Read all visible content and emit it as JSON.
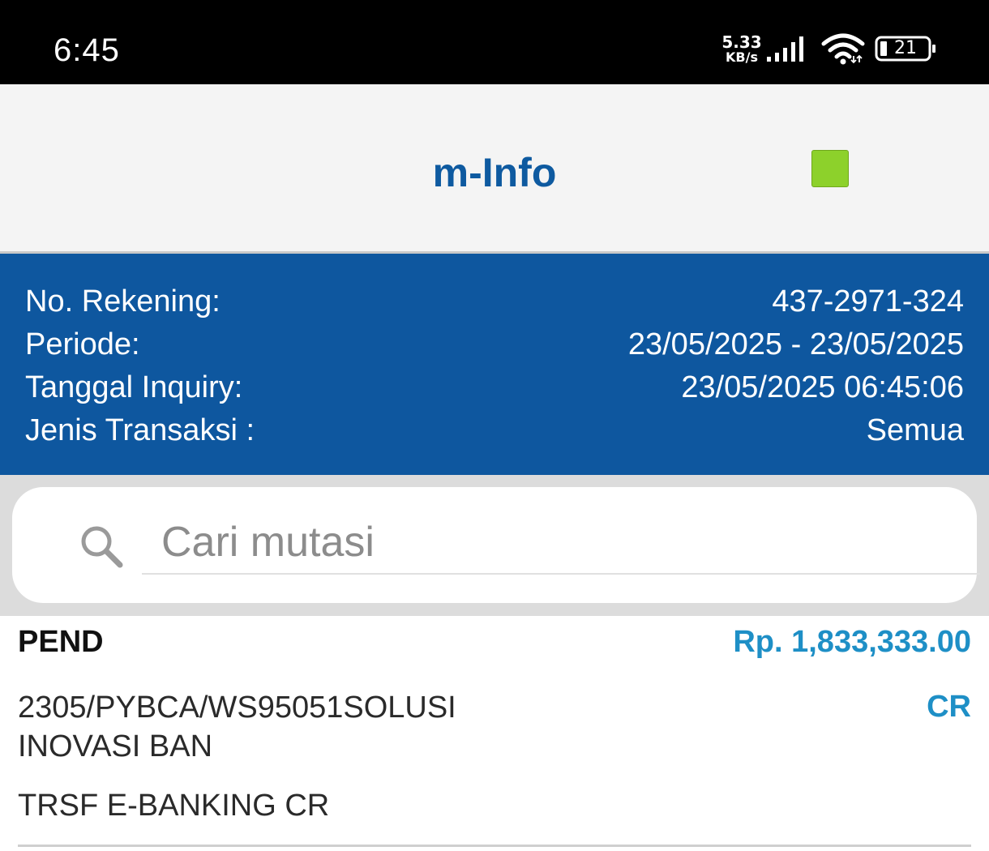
{
  "status_bar": {
    "time": "6:45",
    "net_speed_value": "5.33",
    "net_speed_unit": "KB/s",
    "battery_level": "21",
    "icons": [
      "signal-icon",
      "wifi-icon",
      "battery-icon"
    ]
  },
  "header": {
    "title": "m-Info",
    "indicator_color": "#8dd12b"
  },
  "account": {
    "rows": [
      {
        "label": "No. Rekening:",
        "value": "437-2971-324"
      },
      {
        "label": "Periode:",
        "value": "23/05/2025 - 23/05/2025"
      },
      {
        "label": "Tanggal Inquiry:",
        "value": "23/05/2025 06:45:06"
      },
      {
        "label": "Jenis Transaksi :",
        "value": "Semua"
      }
    ]
  },
  "search": {
    "placeholder": "Cari mutasi",
    "value": ""
  },
  "transactions": [
    {
      "status": "PEND",
      "amount": "Rp. 1,833,333.00",
      "description_lines": [
        "2305/PYBCA/WS95051SOLUSI",
        "INOVASI BAN"
      ],
      "type": "CR",
      "category": "TRSF E-BANKING CR"
    }
  ],
  "colors": {
    "brand_blue": "#0e579f",
    "title_blue": "#0e5aa0",
    "amount_blue": "#1e8fc6",
    "status_black": "#000000"
  }
}
